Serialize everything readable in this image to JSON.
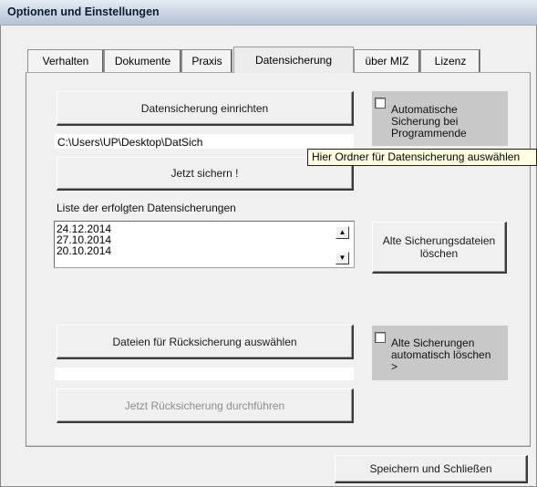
{
  "window": {
    "title": "Optionen und Einstellungen"
  },
  "tabs": [
    {
      "label": "Verhalten",
      "active": false
    },
    {
      "label": "Dokumente",
      "active": false
    },
    {
      "label": "Praxis",
      "active": false
    },
    {
      "label": "Datensicherung",
      "active": true
    },
    {
      "label": "über MIZ",
      "active": false
    },
    {
      "label": "Lizenz",
      "active": false
    }
  ],
  "backup": {
    "setup_button": "Datensicherung einrichten",
    "path_value": "C:\\Users\\UP\\Desktop\\DatSich",
    "save_now_button": "Jetzt sichern !",
    "auto_backup_checkbox": {
      "label": "Automatische Sicherung bei Programmende",
      "checked": false
    },
    "tooltip": "Hier Ordner für Datensicherung auswählen"
  },
  "history": {
    "label": "Liste der erfolgten Datensicherungen",
    "items": [
      "24.12.2014",
      "27.10.2014",
      "20.10.2014"
    ],
    "scroll_up_icon": "up-arrow",
    "scroll_down_icon": "down-arrow",
    "delete_old_button": "Alte Sicherungsdateien löschen"
  },
  "restore": {
    "select_files_button": "Dateien für Rücksicherung  auswählen",
    "selected_files_value": "",
    "run_restore_button": "Jetzt Rücksicherung durchführen",
    "run_restore_enabled": false,
    "auto_delete_checkbox": {
      "label": "Alte Sicherungen automatisch löschen  >",
      "checked": false
    }
  },
  "footer": {
    "save_close_button": "Speichern und Schließen"
  }
}
